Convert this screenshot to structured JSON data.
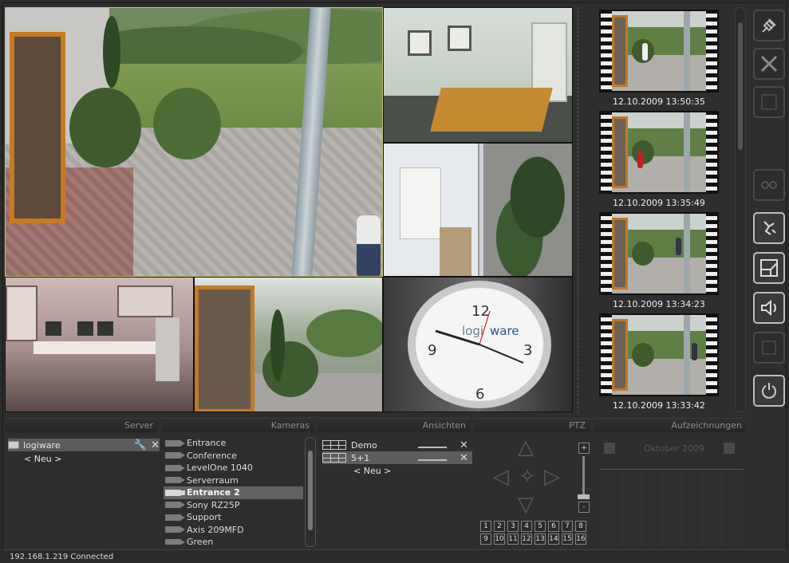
{
  "recordings": [
    {
      "time": "12.10.2009 13:50:35"
    },
    {
      "time": "12.10.2009 13:35:49"
    },
    {
      "time": "12.10.2009 13:34:23"
    },
    {
      "time": "12.10.2009 13:33:42"
    }
  ],
  "panels": {
    "server": "Server",
    "cameras": "Kameras",
    "views": "Ansichten",
    "ptz": "PTZ",
    "recordings": "Aufzeichnungen"
  },
  "server": {
    "items": [
      {
        "label": "logiware"
      }
    ],
    "new_label": "< Neu >"
  },
  "cameras": [
    "Entrance",
    "Conference",
    "LevelOne 1040",
    "Serverraum",
    "Entrance 2",
    "Sony RZ25P",
    "Support",
    "Axis 209MFD",
    "Green"
  ],
  "selected_camera": "Entrance 2",
  "views": {
    "items": [
      {
        "label": "Demo"
      },
      {
        "label": "5+1"
      }
    ],
    "new_label": "< Neu >"
  },
  "ptz": {
    "presets": [
      "1",
      "2",
      "3",
      "4",
      "5",
      "6",
      "7",
      "8",
      "9",
      "10",
      "11",
      "12",
      "13",
      "14",
      "15",
      "16"
    ],
    "zoom_plus": "+",
    "zoom_minus": "-"
  },
  "calendar": {
    "month": "Oktober 2009"
  },
  "clock_brand": {
    "left": "logi",
    "right": "ware"
  },
  "clock_numbers": [
    "12",
    "3",
    "6",
    "9"
  ],
  "status": "192.168.1.219 Connected",
  "toolbar": [
    "plug-icon",
    "tools-icon",
    "grid-icon",
    "tape-icon",
    "alarm-icon",
    "layout-icon",
    "speaker-icon",
    "window-icon",
    "power-icon"
  ],
  "colors": {
    "selection_outline": "#c9c47a",
    "background": "#2e2e2e",
    "door_orange": "#c77a22"
  }
}
